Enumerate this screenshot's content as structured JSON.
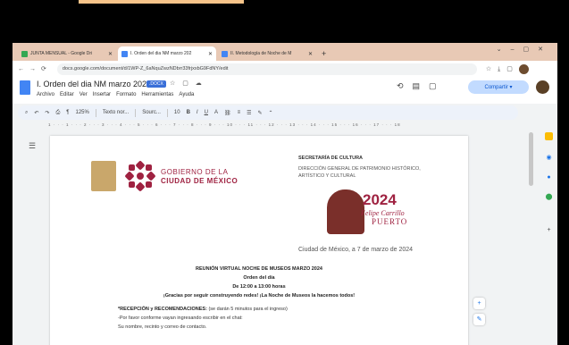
{
  "browser": {
    "tabs": [
      {
        "title": "JUNTA MENSUAL - Google Dri",
        "active": false,
        "color": "#34a853"
      },
      {
        "title": "I. Orden del dia NM marzo 202",
        "active": true,
        "color": "#4285f4"
      },
      {
        "title": "II. Metodología de Noche de M",
        "active": false,
        "color": "#4285f4"
      }
    ],
    "url": "docs.google.com/document/d/1WP-Z_6aNquZwzNDbrr33frjxxbG9FdNY/edit"
  },
  "doc": {
    "title": "I. Orden del dia NM marzo 2024",
    "badge": ".DOCX",
    "menus": [
      "Archivo",
      "Editar",
      "Ver",
      "Insertar",
      "Formato",
      "Herramientas",
      "Ayuda"
    ],
    "share_label": "Compartir",
    "toolbar": {
      "zoom": "125%",
      "style": "Texto nor...",
      "font": "Sourc...",
      "size": "10"
    }
  },
  "letterhead": {
    "gob_line1": "GOBIERNO DE LA",
    "gob_line2": "CIUDAD DE MÉXICO",
    "secretaria": "SECRETARÍA DE CULTURA",
    "direccion": "DIRECCIÓN GENERAL DE PATRIMONIO HISTÓRICO, ARTÍSTICO Y CULTURAL",
    "year": "2024",
    "felipe": "Felipe Carrillo",
    "puerto": "PUERTO"
  },
  "content": {
    "fecha": "Ciudad de México, a 7 de marzo de 2024",
    "heading1": "REUNIÓN VIRTUAL NOCHE DE MUSEOS MARZO 2024",
    "heading2": "Orden del día",
    "heading3": "De 12:00 a 13:00 horas",
    "heading4": "¡Gracias por seguir construyendo redes! ¡La Noche de Museos la hacemos todos!",
    "line1_bold": "*RECEPCIÓN y RECOMENDACIONES:",
    "line1_rest": " (se darán 5 minutos para el ingreso)",
    "line2": "-Por favor conforme vayan ingresando escribir en el chat:",
    "line3": "Su nombre, recinto y correo de contacto."
  }
}
